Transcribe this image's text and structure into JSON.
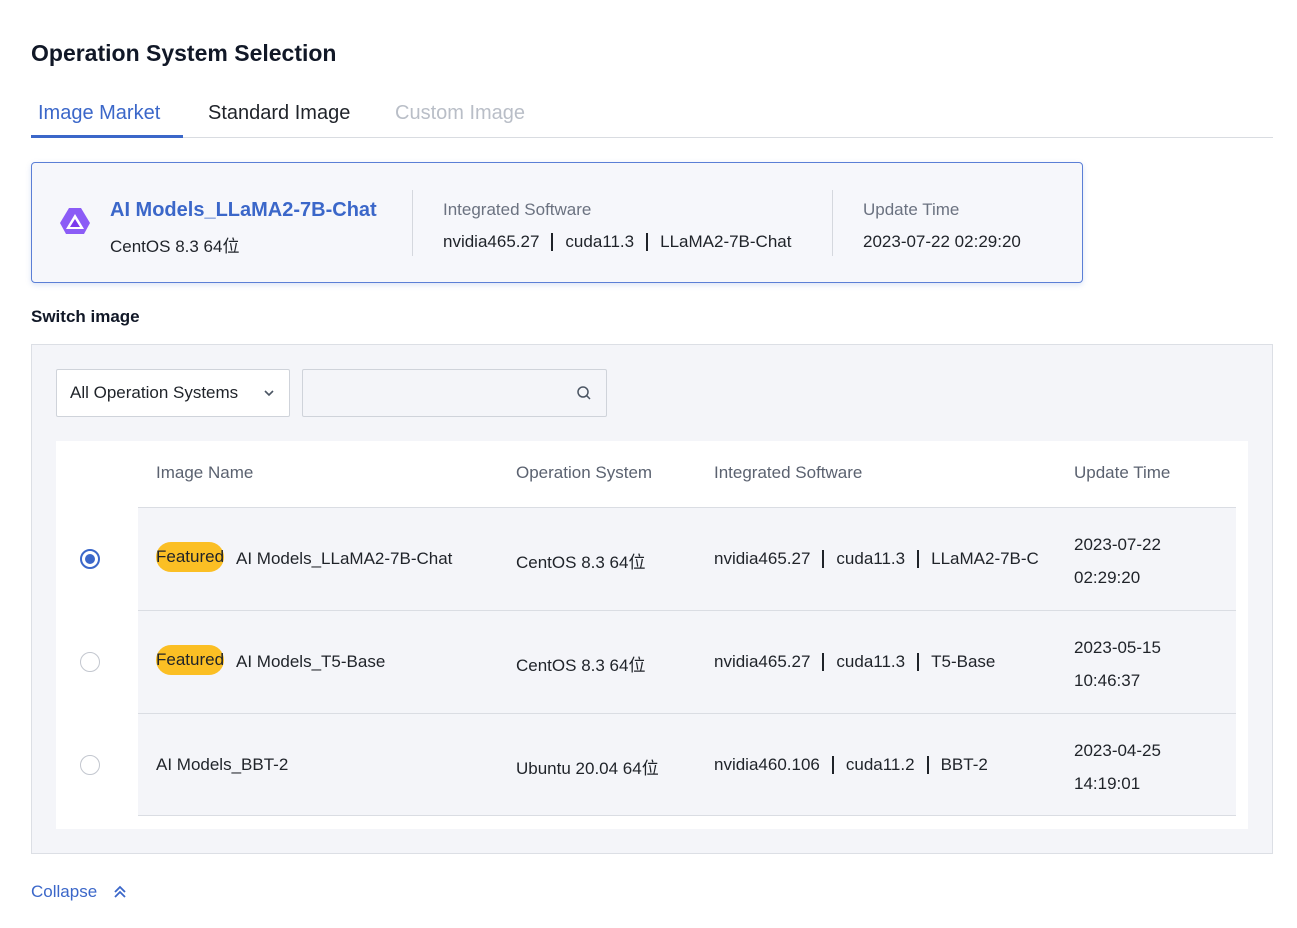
{
  "page_title": "Operation System Selection",
  "tabs": [
    {
      "label": "Image Market",
      "state": "active"
    },
    {
      "label": "Standard Image",
      "state": "normal"
    },
    {
      "label": "Custom Image",
      "state": "disabled"
    }
  ],
  "current_image": {
    "icon": "triangle-logo-icon",
    "name": "AI Models_LLaMA2-7B-Chat",
    "os": "CentOS 8.3 64位",
    "software_label": "Integrated Software",
    "software": [
      "nvidia465.27",
      "cuda11.3",
      "LLaMA2-7B-Chat"
    ],
    "update_label": "Update Time",
    "update_time": "2023-07-22 02:29:20"
  },
  "switch_label": "Switch image",
  "filter": {
    "os_select": "All Operation Systems",
    "search_value": "",
    "search_placeholder": ""
  },
  "table": {
    "headers": [
      "Image Name",
      "Operation System",
      "Integrated Software",
      "Update Time"
    ],
    "rows": [
      {
        "selected": true,
        "badge": "Featured",
        "name": "AI Models_LLaMA2-7B-Chat",
        "os": "CentOS 8.3 64位",
        "software": [
          "nvidia465.27",
          "cuda11.3",
          "LLaMA2-7B-C"
        ],
        "date": "2023-07-22",
        "time": "02:29:20"
      },
      {
        "selected": false,
        "badge": "Featured",
        "name": "AI Models_T5-Base",
        "os": "CentOS 8.3 64位",
        "software": [
          "nvidia465.27",
          "cuda11.3",
          "T5-Base"
        ],
        "date": "2023-05-15",
        "time": "10:46:37"
      },
      {
        "selected": false,
        "badge": "",
        "name": "AI Models_BBT-2",
        "os": "Ubuntu 20.04 64位",
        "software": [
          "nvidia460.106",
          "cuda11.2",
          "BBT-2"
        ],
        "date": "2023-04-25",
        "time": "14:19:01"
      }
    ]
  },
  "collapse_label": "Collapse",
  "colors": {
    "accent": "#3b67c9",
    "badge": "#fbbf24",
    "panel": "#f4f5f9"
  }
}
